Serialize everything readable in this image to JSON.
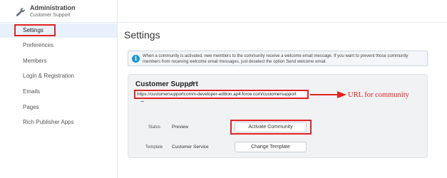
{
  "sidebar": {
    "title": "Administration",
    "subtitle": "Customer Support",
    "items": [
      {
        "label": "Settings"
      },
      {
        "label": "Preferences"
      },
      {
        "label": "Members"
      },
      {
        "label": "Login & Registration"
      },
      {
        "label": "Emails"
      },
      {
        "label": "Pages"
      },
      {
        "label": "Rich Publisher Apps"
      }
    ]
  },
  "main": {
    "title": "Settings",
    "info": "When a community is activated, new members to the community receive a welcome email message. If you want to prevent those community members from receiving welcome email messages, just deselect the option Send welcome email.",
    "community": {
      "name": "Customer Support",
      "url": "https://customersupportcomm-developer-edition.ap4.force.com/customersupport",
      "status_label": "Status",
      "status_value": "Preview",
      "template_label": "Template",
      "template_value": "Customer Service",
      "activate_button": "Activate Community",
      "change_template_button": "Change Template"
    }
  },
  "annotation": {
    "text": "URL for community",
    "color": "#e32421"
  },
  "colors": {
    "accent": "#1b96d8",
    "highlight": "#e32421",
    "active_nav": "#e8f1fb"
  }
}
